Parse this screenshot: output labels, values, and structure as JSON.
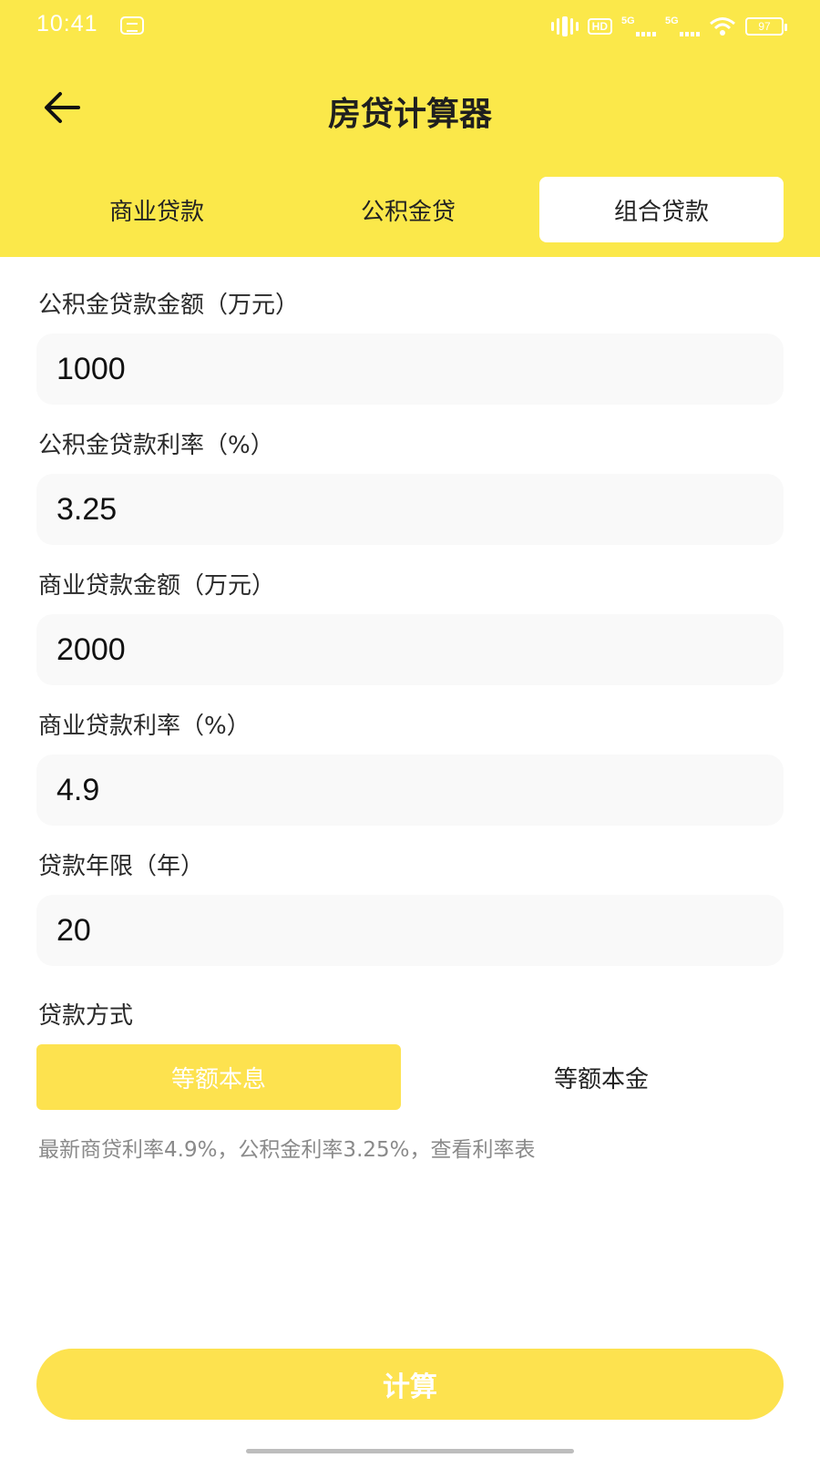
{
  "status_bar": {
    "time": "10:41",
    "hd_label": "HD",
    "signal1_label": "5G",
    "signal2_label": "5G",
    "battery": "97"
  },
  "header": {
    "title": "房贷计算器",
    "back_icon": "arrow-left-icon"
  },
  "tabs": [
    {
      "label": "商业贷款",
      "active": false
    },
    {
      "label": "公积金贷",
      "active": false
    },
    {
      "label": "组合贷款",
      "active": true
    }
  ],
  "form": {
    "fund_amount": {
      "label": "公积金贷款金额（万元）",
      "value": "1000"
    },
    "fund_rate": {
      "label": "公积金贷款利率（%）",
      "value": "3.25"
    },
    "commercial_amount": {
      "label": "商业贷款金额（万元）",
      "value": "2000"
    },
    "commercial_rate": {
      "label": "商业贷款利率（%）",
      "value": "4.9"
    },
    "years": {
      "label": "贷款年限（年）",
      "value": "20"
    }
  },
  "repayment": {
    "label": "贷款方式",
    "options": [
      {
        "label": "等额本息",
        "selected": true
      },
      {
        "label": "等额本金",
        "selected": false
      }
    ]
  },
  "hint": "最新商贷利率4.9%，公积金利率3.25%，查看利率表",
  "calculate_label": "计算",
  "colors": {
    "accent": "#fbe84a",
    "button": "#fde24f",
    "field_bg": "#f9f9f9",
    "hint_text": "#8a8a8a"
  }
}
